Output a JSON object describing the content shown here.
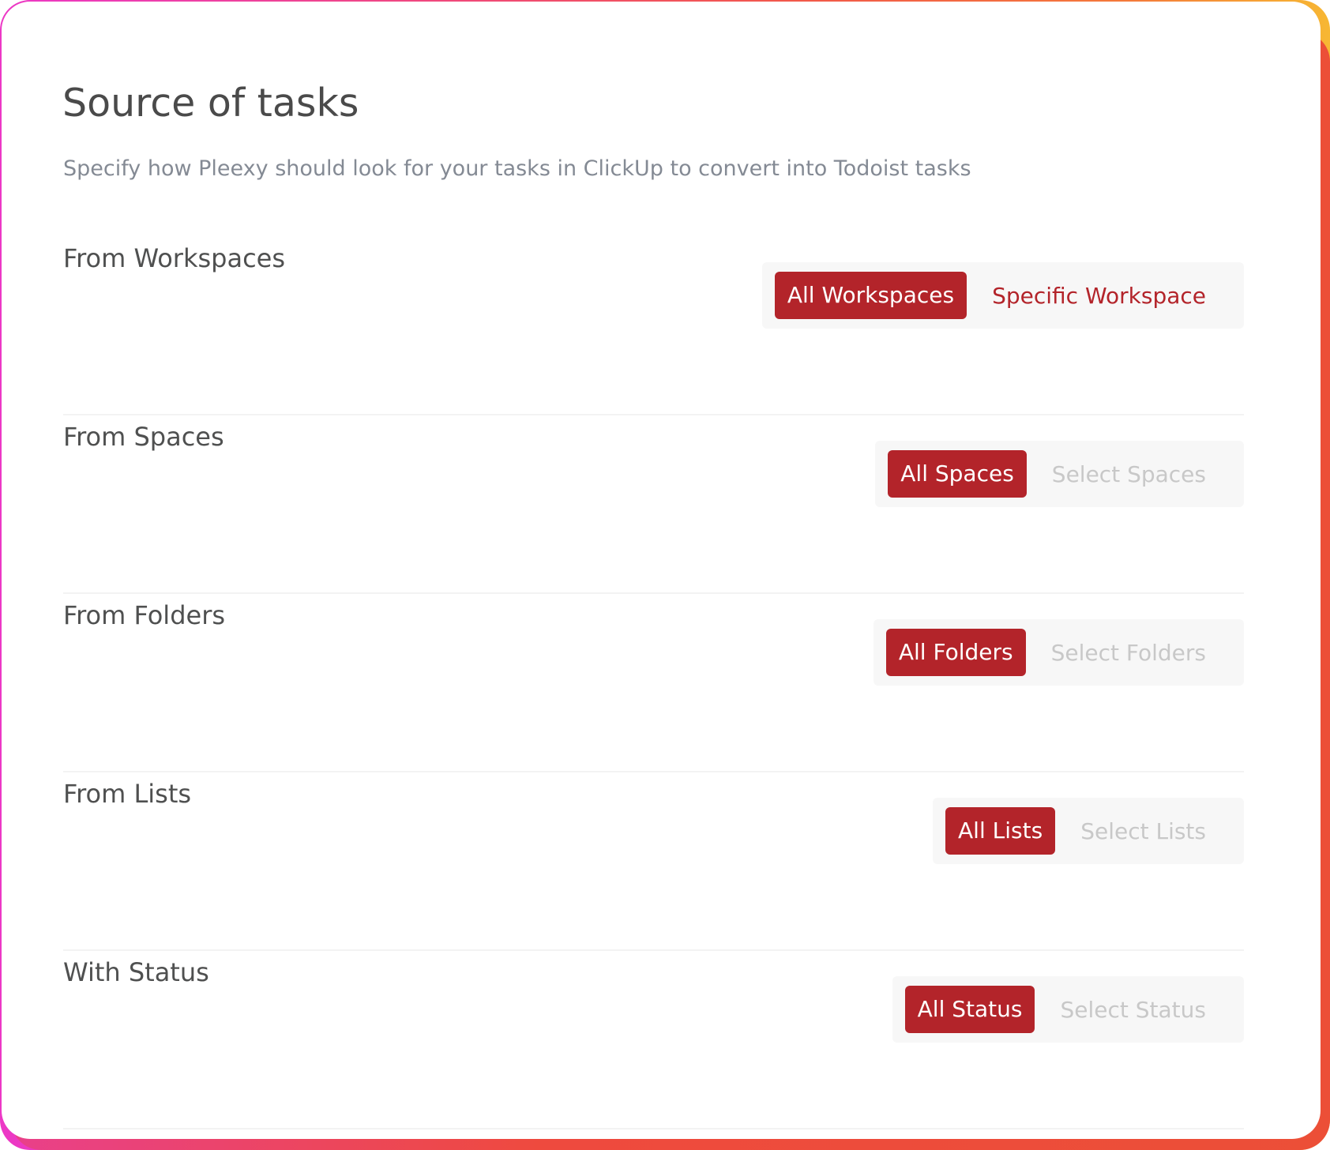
{
  "header": {
    "title": "Source of tasks",
    "subtitle": "Specify how Pleexy should look for your tasks in ClickUp to convert into Todoist tasks"
  },
  "rows": [
    {
      "label": "From Workspaces",
      "active": "All Workspaces",
      "other": "Specific Workspace",
      "other_state": "enabled"
    },
    {
      "label": "From Spaces",
      "active": "All Spaces",
      "other": "Select Spaces",
      "other_state": "disabled"
    },
    {
      "label": "From Folders",
      "active": "All Folders",
      "other": "Select Folders",
      "other_state": "disabled"
    },
    {
      "label": "From Lists",
      "active": "All Lists",
      "other": "Select Lists",
      "other_state": "disabled"
    },
    {
      "label": "With Status",
      "active": "All Status",
      "other": "Select Status",
      "other_state": "disabled"
    }
  ],
  "colors": {
    "accent": "#b3242a",
    "title_text": "#4a4a4a",
    "subtitle_text": "#848a94",
    "disabled_text": "#c8c8c8",
    "toggle_bg": "#f7f7f7"
  }
}
